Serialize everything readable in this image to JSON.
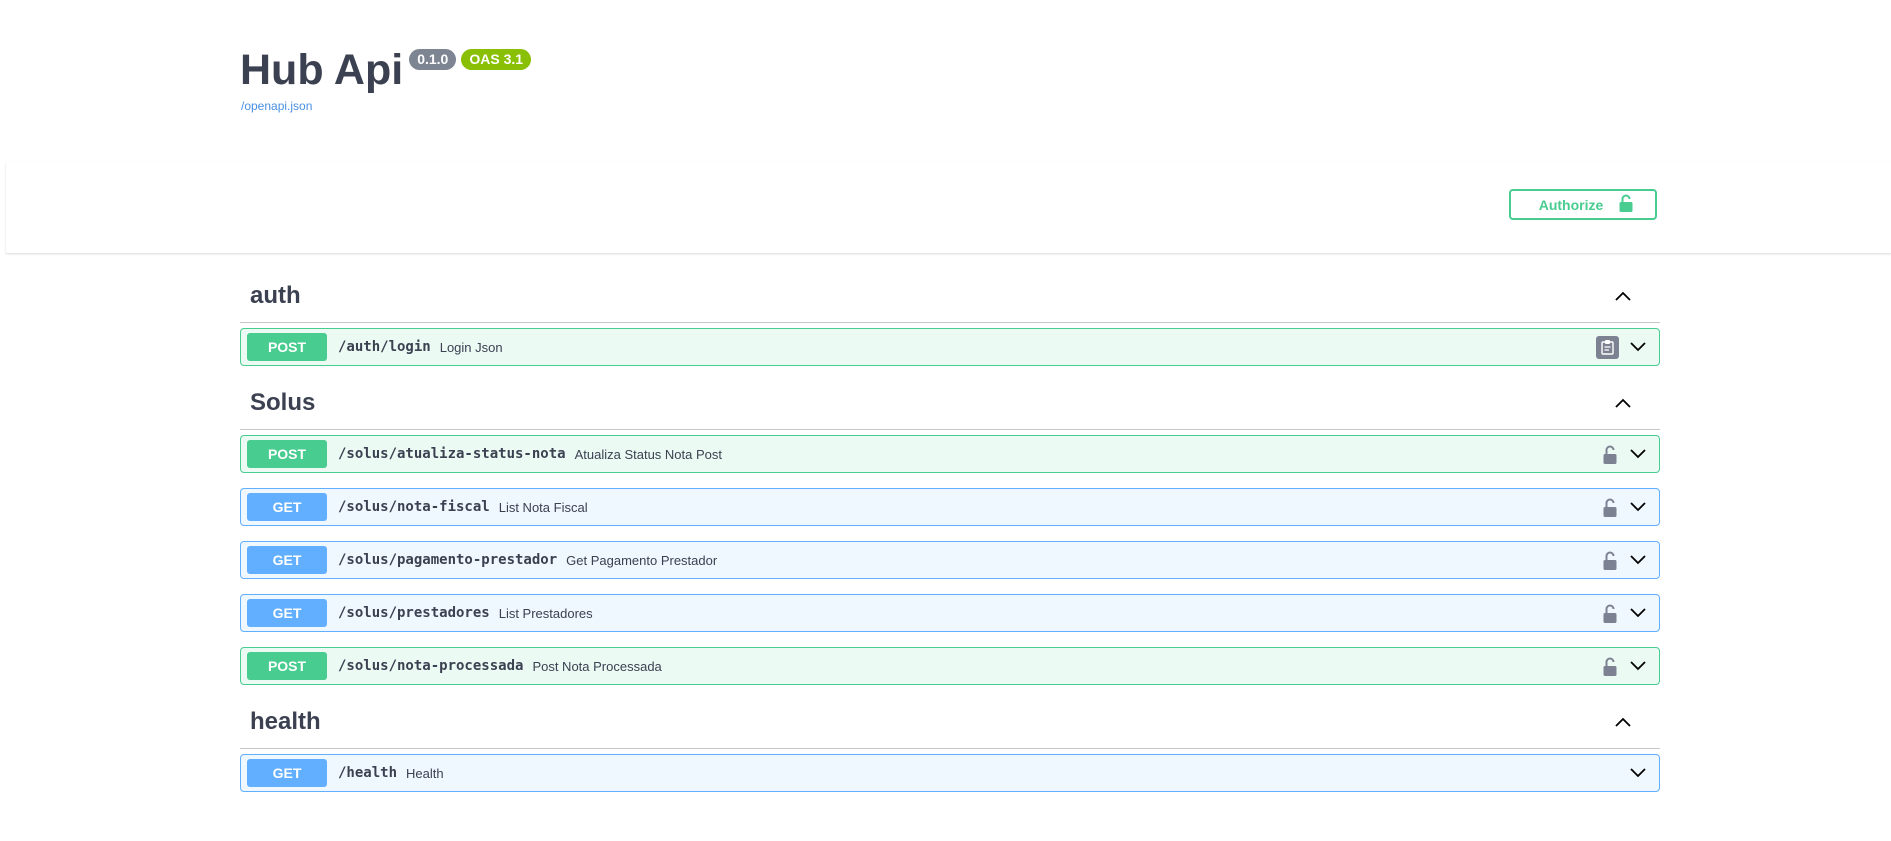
{
  "info": {
    "title": "Hub Api",
    "version": "0.1.0",
    "oas": "OAS 3.1",
    "spec_link": "/openapi.json"
  },
  "authorize": {
    "label": "Authorize",
    "icon": "unlocked-padlock-icon",
    "color": "#49cc90"
  },
  "colors": {
    "post": "#49cc90",
    "get": "#61affe",
    "text": "#3b4151",
    "link": "#4990e2"
  },
  "tags": [
    {
      "name": "auth",
      "operations": [
        {
          "method": "POST",
          "path": "/auth/login",
          "summary": "Login Json",
          "icon": "copy-icon"
        }
      ]
    },
    {
      "name": "Solus",
      "operations": [
        {
          "method": "POST",
          "path": "/solus/atualiza-status-nota",
          "summary": "Atualiza Status Nota Post",
          "icon": "lock-icon"
        },
        {
          "method": "GET",
          "path": "/solus/nota-fiscal",
          "summary": "List Nota Fiscal",
          "icon": "lock-icon"
        },
        {
          "method": "GET",
          "path": "/solus/pagamento-prestador",
          "summary": "Get Pagamento Prestador",
          "icon": "lock-icon"
        },
        {
          "method": "GET",
          "path": "/solus/prestadores",
          "summary": "List Prestadores",
          "icon": "lock-icon"
        },
        {
          "method": "POST",
          "path": "/solus/nota-processada",
          "summary": "Post Nota Processada",
          "icon": "lock-icon"
        }
      ]
    },
    {
      "name": "health",
      "operations": [
        {
          "method": "GET",
          "path": "/health",
          "summary": "Health",
          "icon": "none"
        }
      ]
    }
  ]
}
